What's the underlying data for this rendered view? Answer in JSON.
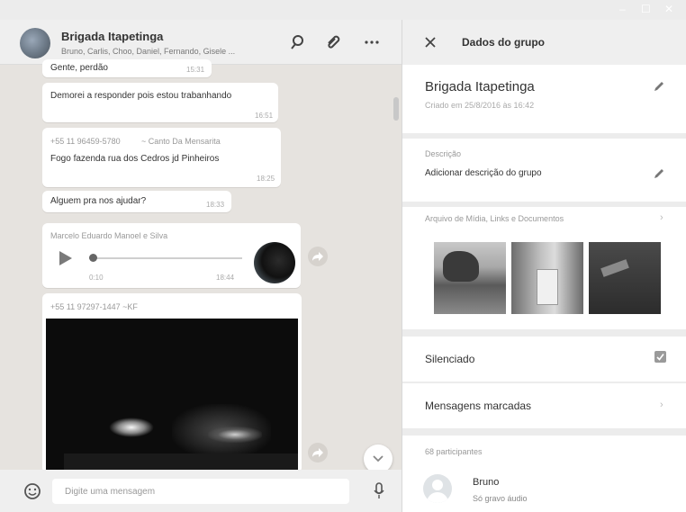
{
  "chat": {
    "title": "Brigada Itapetinga",
    "members": "Bruno, Carlis, Choo, Daniel, Fernando, Gisele ...",
    "messages": [
      {
        "text": "Gente, perdão",
        "time": "15:31"
      },
      {
        "text": "Demorei a responder pois estou trabanhando",
        "time": "16:51"
      },
      {
        "sender_phone": "+55 11 96459-5780",
        "sender_name": "~ Canto Da Mensarita",
        "text": "Fogo fazenda rua dos Cedros jd Pinheiros",
        "time": "18:25"
      },
      {
        "text": "Alguem pra nos ajudar?",
        "time": "18:33"
      },
      {
        "sender": "Marcelo Eduardo Manoel e Silva",
        "audio_duration": "0:10",
        "time": "18:44",
        "audio_progress": 0.02
      },
      {
        "sender": "+55 11 97297-1447 ~KF"
      }
    ],
    "composer_placeholder": "Digite uma mensagem"
  },
  "info": {
    "header_title": "Dados do grupo",
    "group_name": "Brigada Itapetinga",
    "created": "Criado em 25/8/2016 às 16:42",
    "description_label": "Descrição",
    "description_action": "Adicionar descrição do grupo",
    "media_label": "Arquivo de Mídia, Links e Documentos",
    "muted_label": "Silenciado",
    "muted": true,
    "starred_label": "Mensagens marcadas",
    "participants_label": "68 participantes",
    "participant": {
      "name": "Bruno",
      "status": "Só gravo áudio"
    }
  },
  "icons": [
    "search-icon",
    "attach-icon",
    "more-icon",
    "close-icon",
    "pencil-icon",
    "chevron-right-icon",
    "emoji-icon",
    "mic-icon",
    "play-icon",
    "share-icon",
    "chevron-down-icon",
    "checkbox-icon"
  ]
}
